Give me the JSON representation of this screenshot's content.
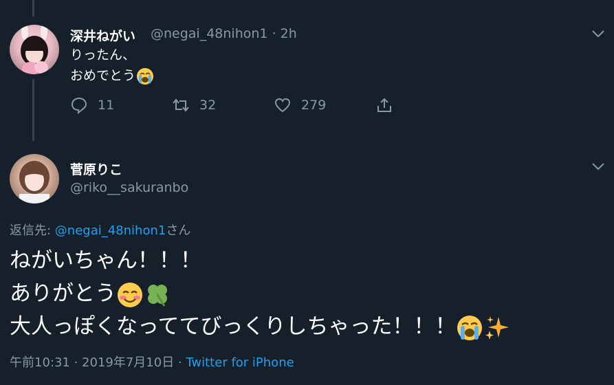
{
  "tweet1": {
    "name": "深井ねがい",
    "handle": "@negai_48nihon1",
    "separator": "·",
    "time": "2h",
    "line1": "りったん、",
    "line2": "おめでとう",
    "line2_emoji": "loudly-crying-face",
    "actions": {
      "reply_count": "11",
      "retweet_count": "32",
      "like_count": "279"
    }
  },
  "tweet2": {
    "name": "菅原りこ",
    "handle": "@riko__sakuranbo",
    "reply_prefix": "返信先: ",
    "reply_target": "@negai_48nihon1",
    "reply_suffix": "さん",
    "line1": "ねがいちゃん！！！",
    "line2": "ありがとう",
    "line2_emojis": [
      "smiling-face-with-blush",
      "four-leaf-clover"
    ],
    "line3": "大人っぽくなっててびっくりしちゃった！！！",
    "line3_emojis": [
      "loudly-crying-face",
      "sparkles"
    ],
    "time": "午前10:31",
    "separator1": " · ",
    "date": "2019年7月10日",
    "separator2": " · ",
    "source": "Twitter for iPhone"
  },
  "colors": {
    "background": "#15202b",
    "secondary_text": "#8899a6",
    "link": "#1da1f2",
    "thread_line": "#38444d"
  }
}
